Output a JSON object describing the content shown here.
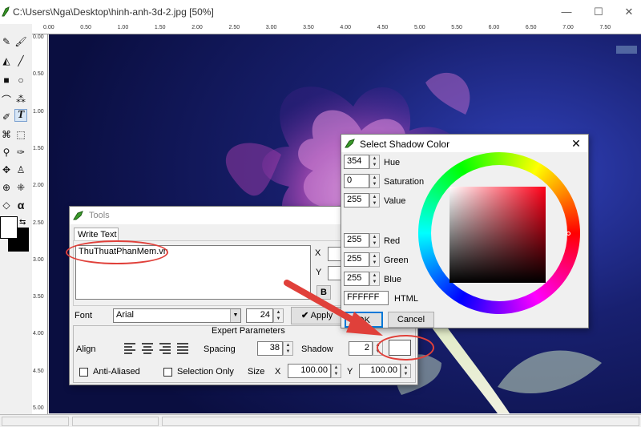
{
  "window": {
    "title": "C:\\Users\\Nga\\Desktop\\hinh-anh-3d-2.jpg [50%]",
    "minimize": "—",
    "maximize": "☐",
    "close": "✕"
  },
  "ruler": {
    "top": [
      "0.00",
      "0.50",
      "1.00",
      "1.50",
      "2.00",
      "2.50",
      "3.00",
      "3.50",
      "4.00",
      "4.50",
      "5.00",
      "5.50",
      "6.00",
      "6.50",
      "7.00",
      "7.50"
    ],
    "left": [
      "0.00",
      "0.50",
      "1.00",
      "1.50",
      "2.00",
      "2.50",
      "3.00",
      "3.50",
      "4.00",
      "4.50",
      "5.00"
    ]
  },
  "tools_dialog": {
    "title": "Tools",
    "tab": "Write Text",
    "text_value": "ThuThuatPhanMem.vn",
    "x_label": "X",
    "y_label": "Y",
    "bold_label": "B",
    "font_label": "Font",
    "font_value": "Arial",
    "size_value": "24",
    "apply_label": "Apply",
    "expert_label": "Expert Parameters",
    "align_label": "Align",
    "spacing_label": "Spacing",
    "spacing_value": "38",
    "shadow_label": "Shadow",
    "shadow_value": "2",
    "anti_aliased_label": "Anti-Aliased",
    "selection_only_label": "Selection Only",
    "size_label": "Size",
    "size_x_label": "X",
    "size_x_value": "100.00",
    "size_y_label": "Y",
    "size_y_value": "100.00"
  },
  "shadow_dialog": {
    "title": "Select Shadow Color",
    "hue_label": "Hue",
    "hue_value": "354",
    "saturation_label": "Saturation",
    "saturation_value": "0",
    "value_label": "Value",
    "value_value": "255",
    "red_label": "Red",
    "red_value": "255",
    "green_label": "Green",
    "green_value": "255",
    "blue_label": "Blue",
    "blue_value": "255",
    "html_label": "HTML",
    "html_value": "FFFFFF",
    "ok_label": "OK",
    "cancel_label": "Cancel"
  },
  "colors": {
    "primary": "#ffffff",
    "secondary": "#000000",
    "shadow": "#ffffff",
    "annotation": "#e0403a"
  },
  "icons": [
    "pencil-icon",
    "brush-icon",
    "fill-bucket-icon",
    "rectangle-icon",
    "ellipse-icon",
    "text-tool-icon",
    "selection-icon",
    "eyedropper-icon",
    "move-icon",
    "stamp-icon",
    "eraser-icon",
    "alpha-icon"
  ]
}
